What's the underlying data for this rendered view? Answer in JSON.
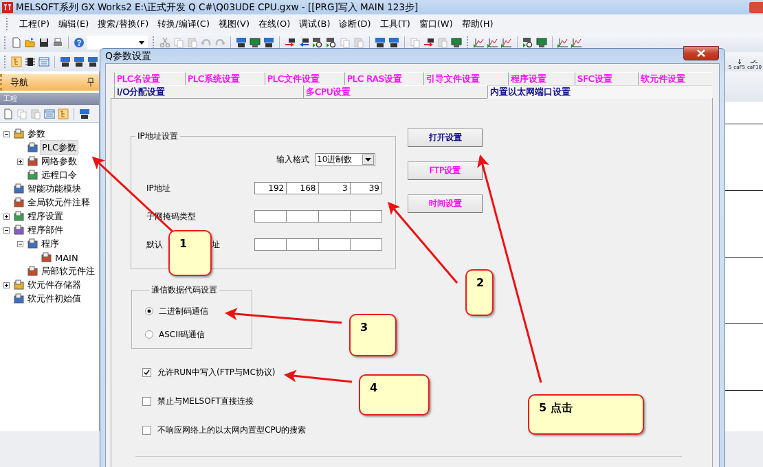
{
  "window": {
    "title": "MELSOFT系列 GX Works2 E:\\正式开发 Q C#\\Q03UDE CPU.gxw - [[PRG]写入 MAIN 123步]"
  },
  "menu": [
    "工程(P)",
    "编辑(E)",
    "搜索/替换(F)",
    "转换/编译(C)",
    "视图(V)",
    "在线(O)",
    "调试(B)",
    "诊断(D)",
    "工具(T)",
    "窗口(W)",
    "帮助(H)"
  ],
  "toolbar_tail": [
    "5",
    "caF5",
    "caF10"
  ],
  "navigator": {
    "title": "导航",
    "section": "工程",
    "tree": [
      {
        "label": "参数",
        "expanded": true,
        "selected": false,
        "children": [
          {
            "label": "PLC参数",
            "selected": true
          },
          {
            "label": "网络参数",
            "expanded": false,
            "selected": false
          },
          {
            "label": "远程口令",
            "selected": false
          }
        ]
      },
      {
        "label": "智能功能模块",
        "selected": false
      },
      {
        "label": "全局软元件注释",
        "selected": false
      },
      {
        "label": "程序设置",
        "expanded": false,
        "selected": false
      },
      {
        "label": "程序部件",
        "expanded": true,
        "selected": false,
        "children": [
          {
            "label": "程序",
            "expanded": true,
            "selected": false,
            "children": [
              {
                "label": "MAIN",
                "selected": false
              }
            ]
          },
          {
            "label": "局部软元件注",
            "selected": false
          }
        ]
      },
      {
        "label": "软元件存储器",
        "expanded": false,
        "selected": false
      },
      {
        "label": "软元件初始值",
        "selected": false
      }
    ]
  },
  "dialog": {
    "title": "Q参数设置",
    "tab_rows": [
      {
        "tabs": [
          {
            "label": "PLC名设置",
            "color": "#ff00ff",
            "selected": false
          },
          {
            "label": "PLC系统设置",
            "color": "#ff00ff",
            "selected": false
          },
          {
            "label": "PLC文件设置",
            "color": "#ff00ff",
            "selected": false
          },
          {
            "label": "PLC RAS设置",
            "color": "#ff00ff",
            "selected": false
          },
          {
            "label": "引导文件设置",
            "color": "#ff00ff",
            "selected": false
          },
          {
            "label": "程序设置",
            "color": "#ff00ff",
            "selected": false
          },
          {
            "label": "SFC设置",
            "color": "#ff00ff",
            "selected": false
          },
          {
            "label": "软元件设置",
            "color": "#ff00ff",
            "selected": false
          }
        ]
      },
      {
        "tabs": [
          {
            "label": "I/O分配设置",
            "color": "#000080",
            "selected": false
          },
          {
            "label": "多CPU设置",
            "color": "#ff00ff",
            "selected": false
          },
          {
            "label": "内置以太网端口设置",
            "color": "#000080",
            "selected": true
          }
        ]
      }
    ],
    "ip_group": {
      "title": "IP地址设置",
      "format_label": "输入格式",
      "format_value": "10进制数",
      "rows": [
        {
          "label_parts": [
            "IP地址"
          ],
          "values": [
            "192",
            "168",
            "3",
            "39"
          ]
        },
        {
          "label_parts": [
            "子网掩码类型"
          ]
        },
        {
          "label_parts": [
            "默认",
            "址"
          ]
        }
      ]
    },
    "buttons": [
      {
        "label": "打开设置",
        "color": "#000080"
      },
      {
        "label": "FTP设置",
        "color": "#ff00ff"
      },
      {
        "label": "时间设置",
        "color": "#ff00ff"
      }
    ],
    "code_group": {
      "title": "通信数据代码设置",
      "options": [
        {
          "label": "二进制码通信",
          "selected": true
        },
        {
          "label": "ASCII码通信",
          "selected": false
        }
      ]
    },
    "checkboxes": [
      {
        "label": "允许RUN中写入(FTP与MC协议)",
        "checked": true
      },
      {
        "label": "禁止与MELSOFT直接连接",
        "checked": false
      },
      {
        "label": "不响应网络上的以太网内置型CPU的搜索",
        "checked": false
      }
    ]
  },
  "callouts": [
    {
      "text": "1"
    },
    {
      "text": "2"
    },
    {
      "text": "3"
    },
    {
      "text": "4"
    },
    {
      "text": "5 点击"
    }
  ]
}
